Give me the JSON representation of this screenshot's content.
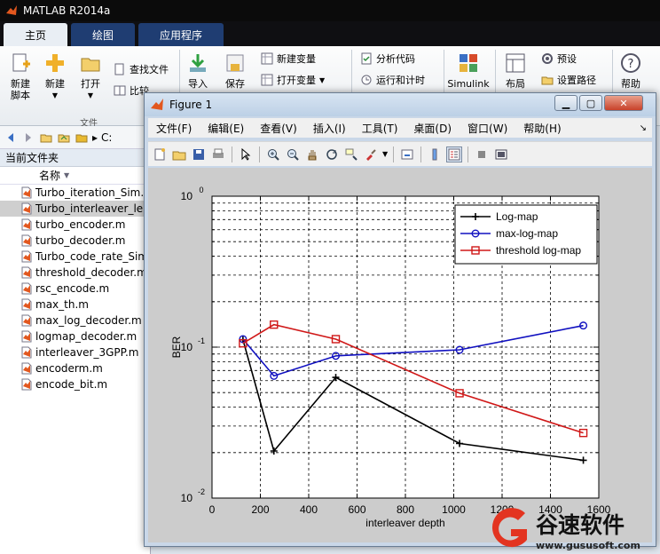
{
  "app": {
    "title": "MATLAB R2014a"
  },
  "ribbon": {
    "tabs": [
      {
        "label": "主页",
        "active": true
      },
      {
        "label": "绘图",
        "active": false
      },
      {
        "label": "应用程序",
        "active": false
      }
    ],
    "buttons": {
      "new_script": "新建\n脚本",
      "new": "新建",
      "open": "打开",
      "find_files": "查找文件",
      "compare": "比较",
      "import": "导入",
      "save": "保存",
      "new_variable": "新建变量",
      "open_variable": "打开变量",
      "analyze_code": "分析代码",
      "run_and_time": "运行和计时",
      "simulink": "Simulink",
      "layout": "布局",
      "preferences": "预设",
      "set_path": "设置路径",
      "help": "帮助"
    },
    "group_file": "文件"
  },
  "address": {
    "path": "C:"
  },
  "folder_panel": {
    "title": "当前文件夹",
    "column_name": "名称",
    "files": [
      {
        "name": "Turbo_iteration_Sim.m",
        "selected": false
      },
      {
        "name": "Turbo_interleaver_len",
        "selected": true
      },
      {
        "name": "turbo_encoder.m",
        "selected": false
      },
      {
        "name": "turbo_decoder.m",
        "selected": false
      },
      {
        "name": "Turbo_code_rate_Sim",
        "selected": false
      },
      {
        "name": "threshold_decoder.m",
        "selected": false
      },
      {
        "name": "rsc_encode.m",
        "selected": false
      },
      {
        "name": "max_th.m",
        "selected": false
      },
      {
        "name": "max_log_decoder.m",
        "selected": false
      },
      {
        "name": "logmap_decoder.m",
        "selected": false
      },
      {
        "name": "interleaver_3GPP.m",
        "selected": false
      },
      {
        "name": "encoderm.m",
        "selected": false
      },
      {
        "name": "encode_bit.m",
        "selected": false
      }
    ]
  },
  "figure": {
    "title": "Figure 1",
    "menus": [
      "文件(F)",
      "编辑(E)",
      "查看(V)",
      "插入(I)",
      "工具(T)",
      "桌面(D)",
      "窗口(W)",
      "帮助(H)"
    ]
  },
  "watermark": {
    "brand": "谷速软件",
    "url": "www.gususoft.com"
  },
  "colors": {
    "black": "#000000",
    "blue": "#1010c0",
    "red": "#d01818",
    "axes_bg": "#ffffff",
    "figure_bg": "#cccccc"
  },
  "chart_data": {
    "type": "line",
    "title": "",
    "xlabel": "interleaver depth",
    "ylabel": "BER",
    "xlim": [
      0,
      1600
    ],
    "ylim": [
      0.01,
      1
    ],
    "yscale": "log",
    "xticks": [
      0,
      200,
      400,
      600,
      800,
      1000,
      1200,
      1400,
      1600
    ],
    "yticks": [
      0.01,
      0.1,
      1
    ],
    "ytick_labels": [
      [
        "10",
        "-2"
      ],
      [
        "10",
        "-1"
      ],
      [
        "10",
        "0"
      ]
    ],
    "grid": true,
    "legend": "top-right",
    "series": [
      {
        "name": "Log-map",
        "color": "#000000",
        "marker": "plus",
        "x": [
          128,
          256,
          512,
          1024,
          1536
        ],
        "y": [
          0.112,
          0.0205,
          0.063,
          0.023,
          0.0178
        ]
      },
      {
        "name": "max-log-map",
        "color": "#1010c0",
        "marker": "circle",
        "x": [
          128,
          256,
          512,
          1024,
          1536
        ],
        "y": [
          0.113,
          0.0645,
          0.0875,
          0.096,
          0.139
        ]
      },
      {
        "name": "threshold log-map",
        "color": "#d01818",
        "marker": "square",
        "x": [
          128,
          256,
          512,
          1024,
          1536
        ],
        "y": [
          0.106,
          0.141,
          0.113,
          0.0495,
          0.027
        ]
      }
    ]
  }
}
